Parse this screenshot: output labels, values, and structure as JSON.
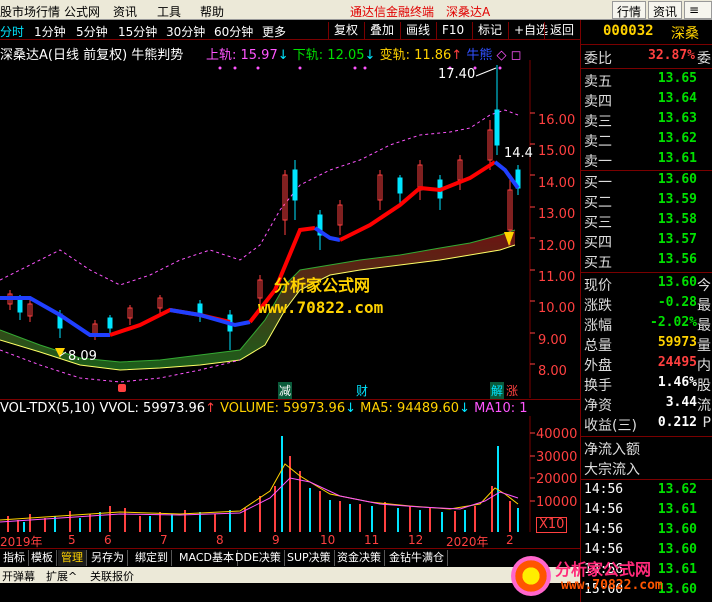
{
  "menubar": {
    "items": [
      "股市场行情",
      "公式网",
      "资讯",
      "工具",
      "帮助"
    ],
    "center_title": "通达信金融终端",
    "stock_title": "深桑达A",
    "right_buttons": [
      "行情",
      "资讯",
      "≡ 个股"
    ]
  },
  "toolbar": {
    "items": [
      "复权",
      "叠加",
      "画线",
      "F10",
      "标记",
      "+自选",
      "返回"
    ]
  },
  "periods": [
    "分时",
    "1分钟",
    "5分钟",
    "15分钟",
    "30分钟",
    "60分钟",
    "更多"
  ],
  "main_header": {
    "name": "深桑达A(日线 前复权) 牛熊判势",
    "upper_label": "上轨: 15.97",
    "upper_arrow": "↓",
    "lower_label": "下轨: 12.05",
    "lower_arrow": "↓",
    "change_label": "变轨: 11.86",
    "change_arrow": "↑",
    "bear_label": "牛熊",
    "bear_marks": "◇ ◻"
  },
  "price_axis": [
    "16.00",
    "15.00",
    "14.00",
    "13.00",
    "12.00",
    "11.00",
    "10.00",
    "9.00",
    "8.00"
  ],
  "annotations": {
    "high": "17.40",
    "high2": "14.4",
    "low": "8.09",
    "watermark_brand": "分析家公式网",
    "watermark_url": "www.70822.com",
    "event_labels": [
      "减",
      "财",
      "解",
      "涨"
    ]
  },
  "vol_header": {
    "name": "VOL-TDX(5,10)",
    "vvol": "VVOL: 59973.96",
    "vvol_arrow": "↑",
    "volume": "VOLUME: 59973.96",
    "volume_arrow": "↓",
    "ma5": "MA5: 94489.60",
    "ma5_arrow": "↓",
    "ma10": "MA10: 1"
  },
  "vol_axis": [
    "40000",
    "30000",
    "20000",
    "10000",
    "X10"
  ],
  "date_axis": [
    "2019年",
    "5",
    "6",
    "7",
    "8",
    "9",
    "10",
    "11",
    "12",
    "2020年",
    "2"
  ],
  "bottom_tabs": [
    "指标",
    "模板",
    "管理",
    "另存为",
    "绑定到",
    "MACD基本",
    "DDE决策",
    "SUP决策",
    "资金决策",
    "金钻牛满仓"
  ],
  "bottom_bar": [
    "开弹幕",
    "扩展^",
    "关联报价"
  ],
  "quote": {
    "code": "000032",
    "name": "深桑",
    "weibi_label": "委比",
    "weibi_value": "32.87%",
    "weicha_value": "委",
    "asks": [
      {
        "label": "卖五",
        "price": "13.65"
      },
      {
        "label": "卖四",
        "price": "13.64"
      },
      {
        "label": "卖三",
        "price": "13.63"
      },
      {
        "label": "卖二",
        "price": "13.62"
      },
      {
        "label": "卖一",
        "price": "13.61"
      }
    ],
    "bids": [
      {
        "label": "买一",
        "price": "13.60"
      },
      {
        "label": "买二",
        "price": "13.59"
      },
      {
        "label": "买三",
        "price": "13.58"
      },
      {
        "label": "买四",
        "price": "13.57"
      },
      {
        "label": "买五",
        "price": "13.56"
      }
    ],
    "stats": [
      {
        "label": "现价",
        "value": "13.60",
        "suffix": "今",
        "color": "#00e000"
      },
      {
        "label": "涨跌",
        "value": "-0.28",
        "suffix": "最",
        "color": "#00e000"
      },
      {
        "label": "涨幅",
        "value": "-2.02%",
        "suffix": "最",
        "color": "#00e000"
      },
      {
        "label": "总量",
        "value": "59973",
        "suffix": "量",
        "color": "#ffd200"
      },
      {
        "label": "外盘",
        "value": "24495",
        "suffix": "内",
        "color": "#ff4040"
      },
      {
        "label": "换手",
        "value": "1.46%",
        "suffix": "股",
        "color": "#ffffff"
      },
      {
        "label": "净资",
        "value": "3.44",
        "suffix": "流",
        "color": "#ffffff"
      },
      {
        "label": "收益(三)",
        "value": "0.212",
        "suffix": "P",
        "color": "#ffffff"
      }
    ],
    "flow_labels": [
      "净流入额",
      "大宗流入"
    ],
    "ticks": [
      {
        "time": "14:56",
        "price": "13.62"
      },
      {
        "time": "14:56",
        "price": "13.61"
      },
      {
        "time": "14:56",
        "price": "13.60"
      },
      {
        "time": "14:56",
        "price": "13.60"
      },
      {
        "time": "14:56",
        "price": "13.61"
      },
      {
        "time": "15:00",
        "price": "13.60"
      }
    ],
    "brand_text": "分析家公式网",
    "brand_url": "www.70822.com"
  }
}
